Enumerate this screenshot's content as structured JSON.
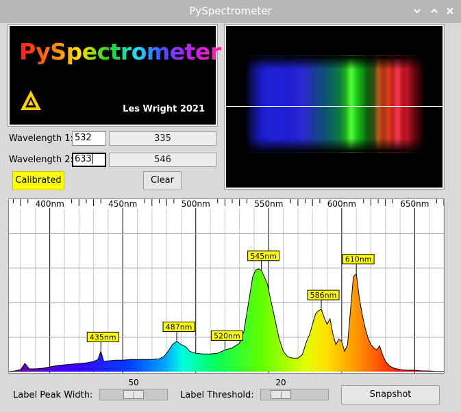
{
  "window": {
    "title": "PySpectrometer",
    "buttons": [
      "minimize-icon",
      "maximize-icon",
      "close-icon"
    ]
  },
  "logo": {
    "name": "PySpectrometer",
    "author": "Les Wright 2021",
    "icon": "warning-triangle-icon"
  },
  "calibration": {
    "wavelength1_label": "Wavelength 1:",
    "wavelength1_value": "532",
    "wavelength1_pixel": "335",
    "wavelength2_label": "Wavelength 2:",
    "wavelength2_value": "633",
    "wavelength2_pixel": "546",
    "calibrated_label": "Calibrated",
    "clear_label": "Clear"
  },
  "camera": {
    "description": "camera-preview"
  },
  "colors": {
    "calibrated_bg": "#ffff00",
    "peak_label_bg": "#ffff00"
  },
  "chart_data": {
    "type": "line",
    "title": "",
    "xlabel": "",
    "ylabel": "",
    "x_ticks": [
      "400nm",
      "450nm",
      "500nm",
      "550nm",
      "600nm",
      "650nm"
    ],
    "x_tick_values": [
      400,
      450,
      500,
      550,
      600,
      650
    ],
    "xlim": [
      372,
      670
    ],
    "ylim": [
      0,
      255
    ],
    "grid": true,
    "x": [
      372,
      376,
      380,
      383,
      386,
      390,
      395,
      400,
      405,
      410,
      415,
      420,
      425,
      430,
      433,
      435,
      437,
      440,
      445,
      450,
      455,
      460,
      465,
      470,
      475,
      478,
      481,
      484,
      487,
      490,
      493,
      496,
      500,
      505,
      510,
      515,
      520,
      525,
      530,
      533,
      536,
      539,
      541,
      543,
      545,
      547,
      549,
      551,
      554,
      557,
      560,
      563,
      566,
      570,
      573,
      576,
      578,
      580,
      582,
      584,
      586,
      588,
      590,
      592,
      594,
      596,
      598,
      600,
      602,
      604,
      606,
      608,
      610,
      612,
      614,
      616,
      618,
      620,
      622,
      624,
      626,
      628,
      630,
      633,
      636,
      640,
      645,
      650,
      655,
      660,
      665,
      670
    ],
    "intensity": [
      0,
      1,
      3,
      12,
      4,
      4,
      5,
      7,
      9,
      10,
      11,
      12,
      13,
      15,
      18,
      30,
      15,
      16,
      17,
      17,
      18,
      18,
      18,
      18,
      19,
      22,
      30,
      40,
      45,
      40,
      37,
      30,
      27,
      26,
      26,
      27,
      32,
      35,
      42,
      60,
      100,
      140,
      150,
      152,
      150,
      140,
      130,
      110,
      80,
      50,
      30,
      22,
      20,
      20,
      25,
      45,
      55,
      70,
      85,
      90,
      92,
      80,
      70,
      78,
      55,
      40,
      48,
      45,
      30,
      40,
      90,
      140,
      145,
      110,
      85,
      65,
      50,
      40,
      35,
      32,
      38,
      25,
      15,
      8,
      5,
      3,
      2,
      2,
      1,
      1,
      0,
      0
    ],
    "peaks": [
      {
        "label": "435nm",
        "x": 435
      },
      {
        "label": "487nm",
        "x": 487
      },
      {
        "label": "520nm",
        "x": 520
      },
      {
        "label": "545nm",
        "x": 545
      },
      {
        "label": "586nm",
        "x": 586
      },
      {
        "label": "610nm",
        "x": 610
      }
    ]
  },
  "controls": {
    "peak_width_label": "Label Peak Width:",
    "peak_width_value": 50,
    "peak_width_range": [
      0,
      100
    ],
    "threshold_label": "Label Threshold:",
    "threshold_value": 20,
    "threshold_range": [
      0,
      100
    ],
    "snapshot_label": "Snapshot"
  }
}
